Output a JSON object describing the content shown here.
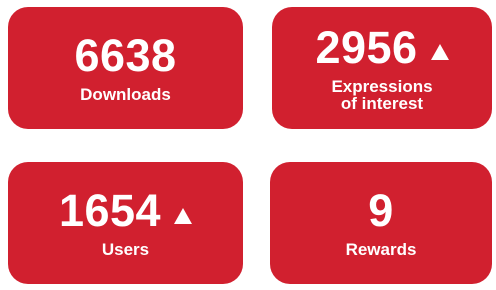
{
  "colors": {
    "card_bg": "#d1202f",
    "text": "#ffffff"
  },
  "cards": [
    {
      "value": "6638",
      "label": "Downloads",
      "trend": null
    },
    {
      "value": "2956",
      "label_lines": [
        "Expressions",
        "of interest"
      ],
      "trend": "up-triangle-icon"
    },
    {
      "value": "1654",
      "label": "Users",
      "trend": "up-triangle-icon"
    },
    {
      "value": "9",
      "label": "Rewards",
      "trend": null
    }
  ]
}
